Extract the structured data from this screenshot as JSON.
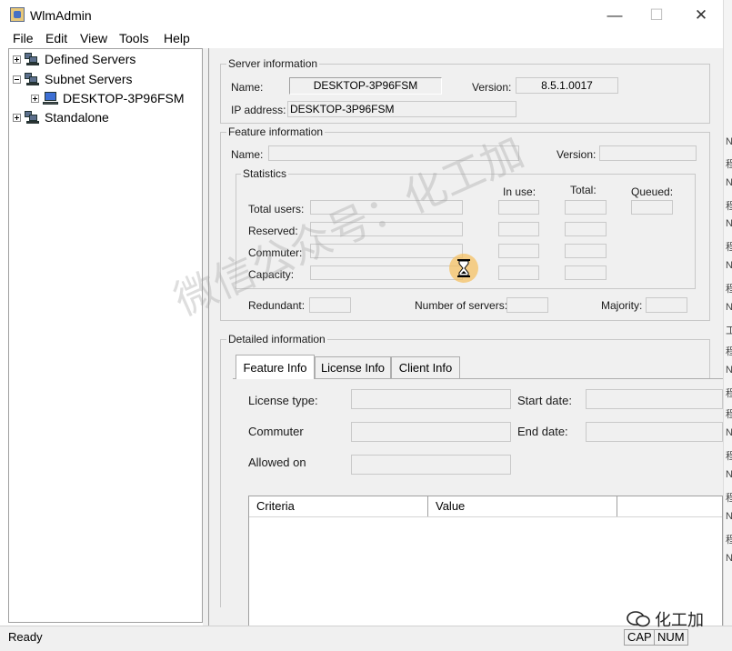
{
  "window": {
    "title": "WlmAdmin",
    "minimize": "—",
    "maximize": "☐",
    "close": "✕"
  },
  "menu": [
    "File",
    "Edit",
    "View",
    "Tools",
    "Help"
  ],
  "tree": {
    "defined_servers": "Defined Servers",
    "subnet_servers": "Subnet Servers",
    "desktop_node": "DESKTOP-3P96FSM",
    "standalone": "Standalone"
  },
  "server_info": {
    "legend": "Server information",
    "name_label": "Name:",
    "name_value": "DESKTOP-3P96FSM",
    "version_label": "Version:",
    "version_value": "8.5.1.0017",
    "ip_label": "IP address:",
    "ip_value": "DESKTOP-3P96FSM"
  },
  "feature_info": {
    "legend": "Feature information",
    "name_label": "Name:",
    "version_label": "Version:",
    "statistics_legend": "Statistics",
    "in_use": "In use:",
    "total": "Total:",
    "queued": "Queued:",
    "total_users": "Total users:",
    "reserved": "Reserved:",
    "commuter": "Commuter:",
    "capacity": "Capacity:",
    "redundant": "Redundant:",
    "number_of_servers": "Number of servers:",
    "majority": "Majority:"
  },
  "detailed_info": {
    "legend": "Detailed information",
    "tabs": [
      "Feature Info",
      "License Info",
      "Client Info"
    ],
    "license_type": "License type:",
    "start_date": "Start date:",
    "commuter": "Commuter",
    "end_date": "End date:",
    "allowed_on": "Allowed on",
    "columns": [
      "Criteria",
      "Value"
    ]
  },
  "status": {
    "text": "Ready",
    "cap": "CAP",
    "num": "NUM"
  },
  "watermark": {
    "text": "微信公众号：化工加",
    "corner": "化工加"
  },
  "right_edge_glyphs": [
    "NI",
    "程",
    "NI",
    "程",
    "NI",
    "程",
    "NI",
    "程",
    "NI",
    "工",
    "程",
    "NI",
    "程",
    "程",
    "NI",
    "程",
    "NI",
    "程",
    "NI",
    "程",
    "NI"
  ]
}
